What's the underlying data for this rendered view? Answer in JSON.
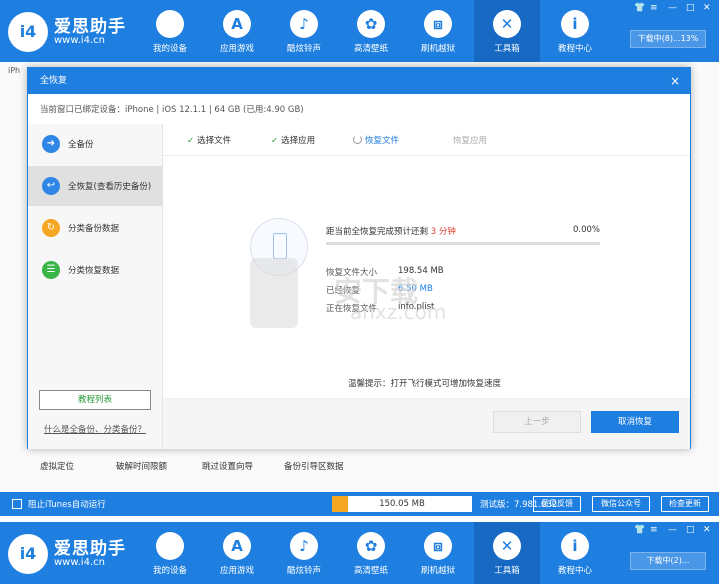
{
  "app": {
    "brand": "爱思助手",
    "url": "www.i4.cn",
    "logo": "i4",
    "nav": [
      {
        "label": "我的设备",
        "icon": "apple-icon",
        "glyph": ""
      },
      {
        "label": "应用游戏",
        "icon": "appstore-icon",
        "glyph": "A"
      },
      {
        "label": "酷炫铃声",
        "icon": "bell-icon",
        "glyph": "♪"
      },
      {
        "label": "高清壁纸",
        "icon": "flower-icon",
        "glyph": "✿"
      },
      {
        "label": "刷机越狱",
        "icon": "box-icon",
        "glyph": "⧈"
      },
      {
        "label": "工具箱",
        "icon": "tools-icon",
        "glyph": "✕"
      },
      {
        "label": "教程中心",
        "icon": "info-icon",
        "glyph": "i"
      }
    ],
    "download_top": "下载中(8)...13%",
    "download_bottom": "下载中(2)..."
  },
  "background": {
    "tab": "iPh",
    "tools": [
      "虚拟定位",
      "破解时间限额",
      "跳过设置向导",
      "备份引导区数据"
    ]
  },
  "modal": {
    "title": "全恢复",
    "close": "×",
    "device_info": "当前窗口已绑定设备：iPhone  |  iOS 12.1.1  |  64 GB (已用:4.90 GB)",
    "sidebar": [
      {
        "label": "全备份",
        "icon": "arrow-right-icon",
        "glyph": "➜",
        "color": "#2f86e6"
      },
      {
        "label": "全恢复(查看历史备份)",
        "icon": "arrow-back-icon",
        "glyph": "↩",
        "color": "#2f86e6"
      },
      {
        "label": "分类备份数据",
        "icon": "backup-category-icon",
        "glyph": "↻",
        "color": "#f5a623"
      },
      {
        "label": "分类恢复数据",
        "icon": "restore-category-icon",
        "glyph": "☰",
        "color": "#3ab54a"
      }
    ],
    "tutorial_button": "教程列表",
    "what_link": "什么是全备份、分类备份？",
    "steps": [
      "选择文件",
      "选择应用",
      "恢复文件",
      "恢复应用"
    ],
    "progress": {
      "label_prefix": "距当前全恢复完成预计还剩",
      "minutes": "3 分钟",
      "percent_text": "0.00%",
      "percent": 0
    },
    "details": [
      {
        "key": "恢复文件大小",
        "value": "198.54 MB"
      },
      {
        "key": "已经恢复",
        "value": "6.50 MB"
      },
      {
        "key": "正在恢复文件",
        "value": "info.plist"
      }
    ],
    "tip": "温馨提示：打开飞行模式可增加恢复速度",
    "prev_button": "上一步",
    "cancel_button": "取消恢复"
  },
  "statusbar": {
    "itunes_label": "阻止iTunes自动运行",
    "storage": "150.05 MB",
    "version": "测试版：7.981.032",
    "buttons": [
      "意见反馈",
      "微信公众号",
      "检查更新"
    ]
  },
  "watermark": {
    "text": "安下载",
    "url": "anxz.com"
  }
}
